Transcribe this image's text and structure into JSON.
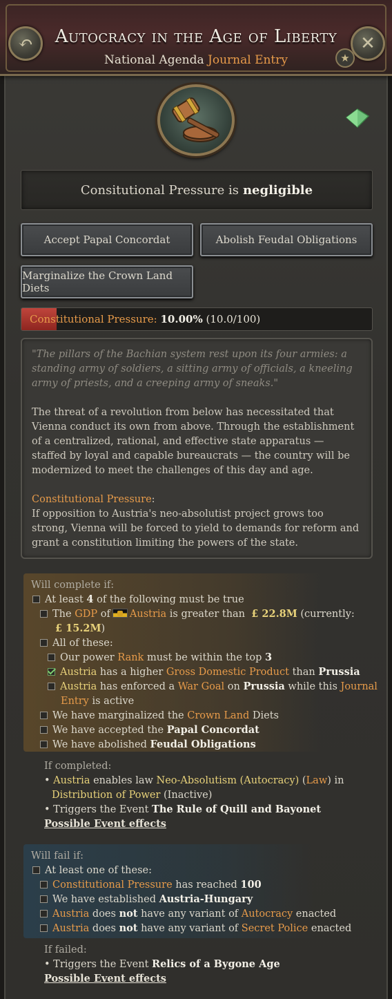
{
  "header": {
    "title": "Autocracy in the Age of Liberty",
    "subtitle_prefix": "National Agenda",
    "subtitle_type": "Journal Entry"
  },
  "status": {
    "prefix": "Consitutional Pressure is",
    "value": "negligible"
  },
  "buttons": {
    "accept_concordat": "Accept Papal Concordat",
    "abolish_feudal": "Abolish Feudal Obligations",
    "marginalize_diets": "Marginalize the Crown Land Diets"
  },
  "progress": {
    "label": "Constitutional Pressure:",
    "percent_text": "10.00%",
    "count_text": "(10.0/100)",
    "fraction": 0.1
  },
  "description": {
    "quote": "\"The pillars of the Bachian system rest upon its four armies: a standing army of soldiers, a sitting army of officials, a kneeling army of priests, and a creeping army of sneaks.\"",
    "body": "The threat of a revolution from below has necessitated that Vienna conduct its own from above. Through the establishment of a centralized, rational, and effective state apparatus — staffed by loyal and capable bureaucrats — the country will be modernized to meet the challenges of this day and age.",
    "pressure_heading": "Constitutional Pressure",
    "pressure_text": "If opposition to Austria's neo-absolutist project grows too strong, Vienna will be forced to yield to demands for reform and grant a constitution limiting the powers of the state."
  },
  "complete": {
    "heading": "Will complete if:",
    "atleast": {
      "pre": "At least",
      "num": "4",
      "post": "of the following must be true"
    },
    "gdp": {
      "the": "The",
      "gdp": "GDP",
      "of": "of",
      "country": "Austria",
      "mid": "is greater than",
      "target": "£ 22.8M",
      "cur_pre": "(currently:",
      "current": "£ 15.2M",
      "cur_post": ")"
    },
    "all_of": "All of these:",
    "rank": {
      "pre": "Our power",
      "rank": "Rank",
      "mid": "must be within the top",
      "num": "3"
    },
    "higher_gdp": {
      "country": "Austria",
      "mid": "has a higher",
      "term": "Gross Domestic Product",
      "than": "than",
      "rival": "Prussia"
    },
    "war_goal": {
      "country": "Austria",
      "mid": "has enforced a",
      "term": "War Goal",
      "on": "on",
      "rival": "Prussia",
      "while": "while this",
      "journal": "Journal",
      "entry": "Entry",
      "active": "is active"
    },
    "diets": {
      "pre": "We have marginalized the",
      "term": "Crown Land",
      "post": "Diets"
    },
    "concordat": {
      "pre": "We have accepted the",
      "term": "Papal Concordat"
    },
    "feudal": {
      "pre": "We have abolished",
      "term": "Feudal Obligations"
    }
  },
  "if_completed": {
    "heading": "If completed:",
    "law": {
      "country": "Austria",
      "mid": "enables law",
      "law": "Neo-Absolutism (Autocracy)",
      "open": "(",
      "tag": "Law",
      "close": ") in",
      "group": "Distribution of Power",
      "state": "(Inactive)"
    },
    "event": {
      "pre": "Triggers the Event",
      "name": "The Rule of Quill and Bayonet"
    },
    "effects_link": "Possible Event effects"
  },
  "fail": {
    "heading": "Will fail if:",
    "atleast": "At least one of these:",
    "pressure": {
      "term": "Constitutional Pressure",
      "mid": "has reached",
      "num": "100"
    },
    "hungary": {
      "pre": "We have established",
      "term": "Austria-Hungary"
    },
    "autocracy": {
      "country": "Austria",
      "does": "does",
      "not": "not",
      "mid": "have any variant of",
      "term": "Autocracy",
      "post": "enacted"
    },
    "police": {
      "country": "Austria",
      "does": "does",
      "not": "not",
      "mid": "have any variant of",
      "term": "Secret Police",
      "post": "enacted"
    }
  },
  "if_failed": {
    "heading": "If failed:",
    "event": {
      "pre": "Triggers the Event",
      "name": "Relics of a Bygone Age"
    },
    "effects_link": "Possible Event effects"
  },
  "colors": {
    "accent_orange": "#e79b4a",
    "accent_yellow": "#e8d27a",
    "progress_red": "#c0453c"
  }
}
